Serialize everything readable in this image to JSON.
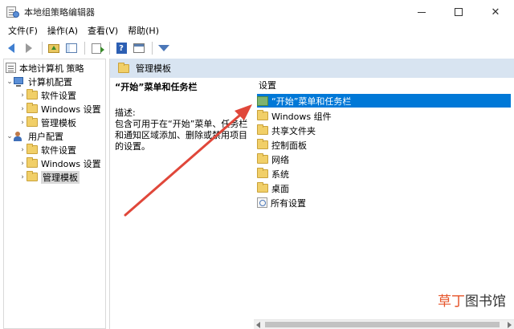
{
  "window": {
    "title": "本地组策略编辑器",
    "minimize_glyph": "—",
    "close_glyph": "✕"
  },
  "menubar": {
    "items": [
      "文件(F)",
      "操作(A)",
      "查看(V)",
      "帮助(H)"
    ]
  },
  "toolbar": {
    "icons": [
      "back-arrow-icon",
      "forward-arrow-icon",
      "up-folder-icon",
      "show-hide-tree-icon",
      "export-list-icon",
      "help-icon",
      "properties-icon",
      "filter-icon"
    ],
    "help_glyph": "?"
  },
  "tree": {
    "root": "本地计算机 策略",
    "computer_config": {
      "label": "计算机配置",
      "children": [
        "软件设置",
        "Windows 设置",
        "管理模板"
      ]
    },
    "user_config": {
      "label": "用户配置",
      "children": [
        "软件设置",
        "Windows 设置",
        "管理模板"
      ]
    },
    "chevron_collapsed": "›",
    "chevron_expanded": "⌄",
    "selected": "管理模板"
  },
  "main": {
    "header_title": "管理模板",
    "selected_title": "“开始”菜单和任务栏",
    "description_label": "描述:",
    "description_text": "包含可用于在“开始”菜单、任务栏和通知区域添加、删除或禁用项目的设置。",
    "list_header": "设置",
    "list_items": [
      {
        "label": "“开始”菜单和任务栏",
        "icon": "green-folder-icon",
        "selected": true
      },
      {
        "label": "Windows 组件",
        "icon": "folder-icon",
        "selected": false
      },
      {
        "label": "共享文件夹",
        "icon": "folder-icon",
        "selected": false
      },
      {
        "label": "控制面板",
        "icon": "folder-icon",
        "selected": false
      },
      {
        "label": "网络",
        "icon": "folder-icon",
        "selected": false
      },
      {
        "label": "系统",
        "icon": "folder-icon",
        "selected": false
      },
      {
        "label": "桌面",
        "icon": "folder-icon",
        "selected": false
      },
      {
        "label": "所有设置",
        "icon": "settings-icon",
        "selected": false
      }
    ]
  },
  "watermark": {
    "accent": "草丁",
    "rest": "图书馆"
  },
  "colors": {
    "selection": "#0078d7",
    "header_band": "#d8e4f1",
    "annotation_arrow": "#e0473a"
  }
}
